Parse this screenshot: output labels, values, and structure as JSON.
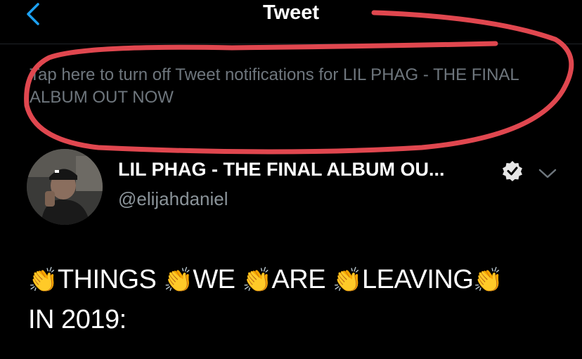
{
  "nav": {
    "title": "Tweet",
    "back_icon": "chevron-left-icon",
    "accent_color": "#1da1f2"
  },
  "banner": {
    "text": "Tap here to turn off Tweet notifications for LIL PHAG - THE FINAL ALBUM OUT NOW",
    "annotation_color": "#e0474f"
  },
  "author": {
    "display_name": "LIL PHAG - THE FINAL ALBUM OU...",
    "handle": "@elijahdaniel",
    "verified_icon": "verified-badge-icon",
    "menu_icon": "chevron-down-icon"
  },
  "tweet": {
    "clap": "👏",
    "words": [
      "THINGS",
      "WE",
      "ARE",
      "LEAVING"
    ],
    "line2": "IN 2019:"
  }
}
